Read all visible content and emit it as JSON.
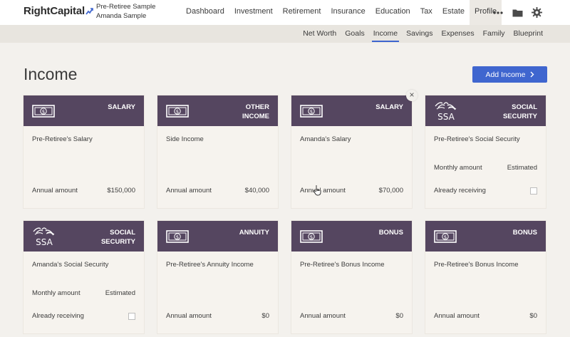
{
  "brand": {
    "name": "RightCapital"
  },
  "client": {
    "line1": "Pre-Retiree Sample",
    "line2": "Amanda Sample"
  },
  "mainnav": [
    {
      "label": "Dashboard",
      "active": false
    },
    {
      "label": "Investment",
      "active": false
    },
    {
      "label": "Retirement",
      "active": false
    },
    {
      "label": "Insurance",
      "active": false
    },
    {
      "label": "Education",
      "active": false
    },
    {
      "label": "Tax",
      "active": false
    },
    {
      "label": "Estate",
      "active": false
    },
    {
      "label": "Profile",
      "active": true
    }
  ],
  "subnav": [
    {
      "label": "Net Worth",
      "active": false
    },
    {
      "label": "Goals",
      "active": false
    },
    {
      "label": "Income",
      "active": true
    },
    {
      "label": "Savings",
      "active": false
    },
    {
      "label": "Expenses",
      "active": false
    },
    {
      "label": "Family",
      "active": false
    },
    {
      "label": "Blueprint",
      "active": false
    }
  ],
  "page": {
    "title": "Income",
    "add_button": "Add Income"
  },
  "cards": [
    {
      "type_line1": "SALARY",
      "type_line2": "",
      "icon": "cash-icon",
      "name": "Pre-Retiree's Salary",
      "annual_label": "Annual amount",
      "annual_value": "$150,000"
    },
    {
      "type_line1": "OTHER",
      "type_line2": "INCOME",
      "icon": "cash-icon",
      "name": "Side Income",
      "annual_label": "Annual amount",
      "annual_value": "$40,000"
    },
    {
      "type_line1": "SALARY",
      "type_line2": "",
      "icon": "cash-icon",
      "name": "Amanda's Salary",
      "annual_label": "Annual amount",
      "annual_value": "$70,000"
    },
    {
      "type_line1": "SOCIAL",
      "type_line2": "SECURITY",
      "icon": "ssa-logo-icon",
      "ssa_text": "SSA",
      "name": "Pre-Retiree's Social Security",
      "monthly_label": "Monthly amount",
      "monthly_value": "Estimated",
      "receiving_label": "Already receiving"
    },
    {
      "type_line1": "SOCIAL",
      "type_line2": "SECURITY",
      "icon": "ssa-logo-icon",
      "ssa_text": "SSA",
      "name": "Amanda's Social Security",
      "monthly_label": "Monthly amount",
      "monthly_value": "Estimated",
      "receiving_label": "Already receiving"
    },
    {
      "type_line1": "ANNUITY",
      "type_line2": "",
      "icon": "cash-icon",
      "name": "Pre-Retiree's Annuity Income",
      "annual_label": "Annual amount",
      "annual_value": "$0"
    },
    {
      "type_line1": "BONUS",
      "type_line2": "",
      "icon": "cash-icon",
      "name": "Pre-Retiree's Bonus Income",
      "annual_label": "Annual amount",
      "annual_value": "$0"
    },
    {
      "type_line1": "BONUS",
      "type_line2": "",
      "icon": "cash-icon",
      "name": "Pre-Retiree's Bonus Income",
      "annual_label": "Annual amount",
      "annual_value": "$0"
    }
  ],
  "colors": {
    "card_header": "#554660",
    "accent": "#3f66cf",
    "background": "#f3f1ed"
  },
  "icons": [
    "more-icon",
    "folder-icon",
    "gear-icon",
    "close-icon",
    "chevron-right-icon"
  ]
}
